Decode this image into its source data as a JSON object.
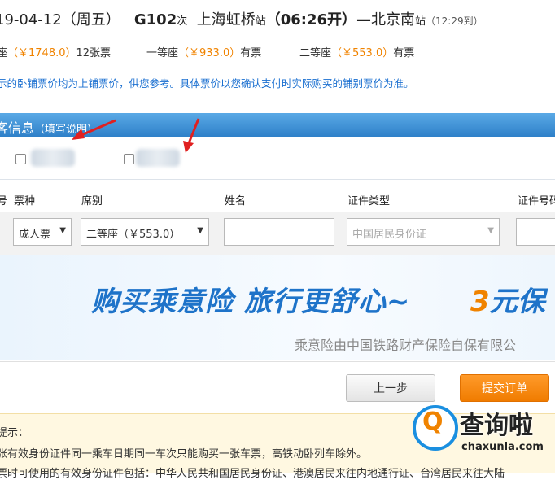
{
  "train": {
    "date": "19-04-12",
    "weekday": "（周五）",
    "number": "G102",
    "number_suffix": "次",
    "from": "上海虹桥",
    "from_suffix": "站",
    "depart": "（06:26开）",
    "dash": "—",
    "to": "北京南",
    "to_suffix": "站",
    "arrive": "（12:29到）"
  },
  "seats": [
    {
      "name": "座",
      "price": "（￥1748.0）",
      "avail": "12张票"
    },
    {
      "name": "一等座",
      "price": "（￥933.0）",
      "avail": "有票"
    },
    {
      "name": "二等座",
      "price": "（￥553.0）",
      "avail": "有票"
    }
  ],
  "note": "示的卧铺票价均为上铺票价，供您参考。具体票价以您确认支付时实际购买的铺别票价为准。",
  "passenger_section": {
    "title": "客信息",
    "hint": "（填写说明）"
  },
  "table": {
    "headers": [
      "号",
      "票种",
      "席别",
      "姓名",
      "证件类型",
      "证件号码"
    ],
    "ticket_type": "成人票",
    "seat_class": "二等座（￥553.0）",
    "id_type": "中国居民身份证"
  },
  "ad": {
    "headline": "购买乘意险  旅行更舒心~",
    "promo_prefix": "3",
    "promo_rest": "元保",
    "subline": "乘意险由中国铁路财产保险自保有限公"
  },
  "buttons": {
    "prev": "上一步",
    "submit": "提交订单"
  },
  "tips": {
    "title": "提示：",
    "line1": "张有效身份证件同一乘车日期同一车次只能购买一张车票，高铁动卧列车除外。",
    "line2": "票时可使用的有效身份证件包括：中华人民共和国居民身份证、港澳居民来往内地通行证、台湾居民来往大陆"
  },
  "watermark": {
    "name": "查询啦",
    "domain": "chaxunla.com"
  },
  "colors": {
    "accent_blue": "#2d7fc8",
    "price_orange": "#f08300",
    "arrow_red": "#e02020"
  }
}
